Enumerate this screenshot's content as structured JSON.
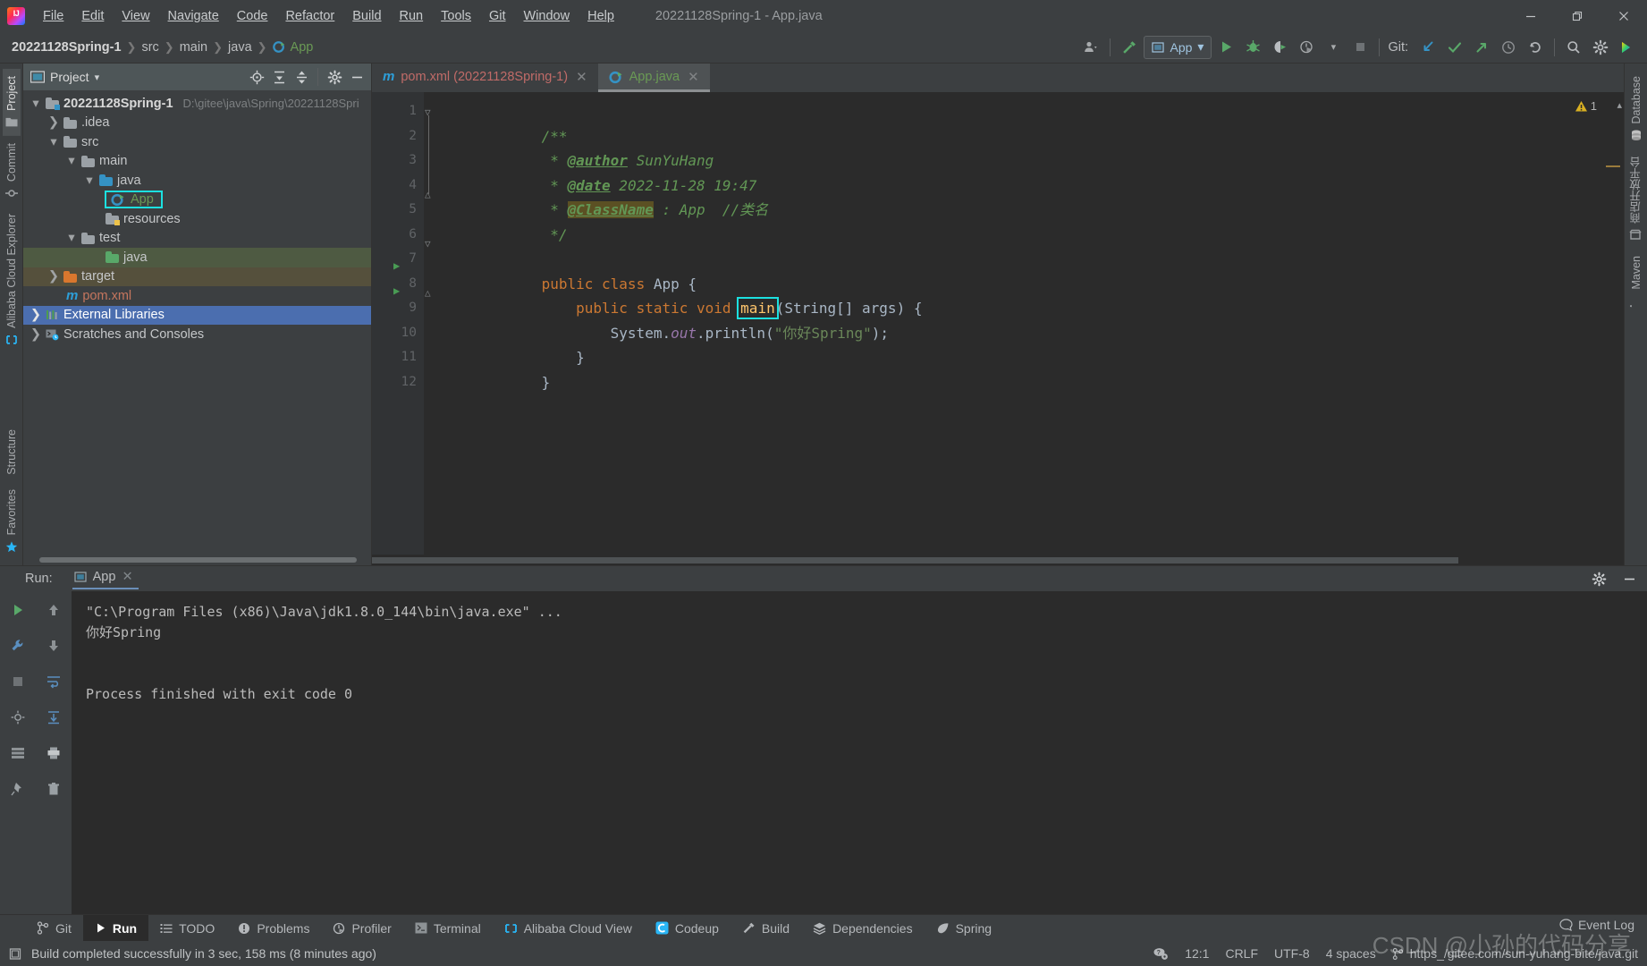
{
  "window": {
    "title": "20221128Spring-1 - App.java",
    "minimize": "minimize-icon",
    "maximize": "maximize-icon",
    "close": "close-icon"
  },
  "menu": [
    {
      "label": "File"
    },
    {
      "label": "Edit"
    },
    {
      "label": "View"
    },
    {
      "label": "Navigate"
    },
    {
      "label": "Code"
    },
    {
      "label": "Refactor"
    },
    {
      "label": "Build"
    },
    {
      "label": "Run"
    },
    {
      "label": "Tools"
    },
    {
      "label": "Git"
    },
    {
      "label": "Window"
    },
    {
      "label": "Help"
    }
  ],
  "breadcrumbs": [
    {
      "label": "20221128Spring-1"
    },
    {
      "label": "src"
    },
    {
      "label": "main"
    },
    {
      "label": "java"
    },
    {
      "label": "App"
    }
  ],
  "toolbar": {
    "run_config": "App",
    "git_label": "Git:",
    "update_project": "update-project-icon",
    "commit": "commit-icon",
    "push": "push-icon",
    "history": "history-icon",
    "rollback": "rollback-icon",
    "search": "search-icon",
    "settings": "settings-icon",
    "run": "run-icon",
    "debug": "debug-icon",
    "run_coverage": "run-coverage-icon",
    "profile": "profile-icon",
    "stop": "stop-icon",
    "build": "build-hammer-icon",
    "account": "account-icon"
  },
  "left_strip": [
    {
      "label": "Project",
      "icon": "project-folder-icon",
      "active": true
    },
    {
      "label": "Commit",
      "icon": "commit-icon",
      "active": false
    },
    {
      "label": "Alibaba Cloud Explorer",
      "icon": "alibaba-cloud-icon",
      "active": false
    }
  ],
  "left_strip_bottom": [
    {
      "label": "Structure",
      "icon": "structure-icon"
    },
    {
      "label": "Favorites",
      "icon": "favorites-star-icon"
    }
  ],
  "right_strip": [
    {
      "label": "Database",
      "icon": "database-icon"
    },
    {
      "label": "商店开放平台",
      "icon": "store-icon"
    },
    {
      "label": "Maven",
      "icon": "maven-m-icon"
    }
  ],
  "project_panel": {
    "title": "Project",
    "buttons": [
      "locate-icon",
      "expand-all-icon",
      "collapse-all-icon",
      "settings-gear-icon",
      "hide-icon"
    ],
    "tree": [
      {
        "label": "20221128Spring-1",
        "path": "D:\\gitee\\java\\Spring\\20221128Spri",
        "indent": 0,
        "arrow": "down",
        "icon": "project-folder-icon",
        "bold": true,
        "highlight": "none"
      },
      {
        "label": ".idea",
        "path": "",
        "indent": 1,
        "arrow": "right",
        "icon": "folder-gray",
        "bold": false,
        "highlight": "none"
      },
      {
        "label": "src",
        "path": "",
        "indent": 1,
        "arrow": "down",
        "icon": "folder-gray",
        "bold": false,
        "highlight": "none"
      },
      {
        "label": "main",
        "path": "",
        "indent": 2,
        "arrow": "down",
        "icon": "folder-gray",
        "bold": false,
        "highlight": "none"
      },
      {
        "label": "java",
        "path": "",
        "indent": 3,
        "arrow": "down",
        "icon": "folder-blue",
        "bold": false,
        "highlight": "none"
      },
      {
        "label": "App",
        "path": "",
        "indent": 4,
        "arrow": "none",
        "icon": "java-class-run-icon",
        "bold": false,
        "highlight": "box"
      },
      {
        "label": "resources",
        "path": "",
        "indent": 3,
        "arrow": "none",
        "icon": "folder-resources",
        "bold": false,
        "highlight": "none"
      },
      {
        "label": "test",
        "path": "",
        "indent": 2,
        "arrow": "down",
        "icon": "folder-gray",
        "bold": false,
        "highlight": "none"
      },
      {
        "label": "java",
        "path": "",
        "indent": 3,
        "arrow": "none",
        "icon": "folder-green",
        "bold": false,
        "highlight": "green"
      },
      {
        "label": "target",
        "path": "",
        "indent": 1,
        "arrow": "right",
        "icon": "folder-orange",
        "bold": false,
        "highlight": "brown"
      },
      {
        "label": "pom.xml",
        "path": "",
        "indent": 2,
        "arrow": "none",
        "icon": "maven-m-icon",
        "bold": false,
        "highlight": "none"
      },
      {
        "label": "External Libraries",
        "path": "",
        "indent": 0,
        "arrow": "right",
        "icon": "libraries-icon",
        "bold": false,
        "highlight": "blue"
      },
      {
        "label": "Scratches and Consoles",
        "path": "",
        "indent": 0,
        "arrow": "right",
        "icon": "scratches-icon",
        "bold": false,
        "highlight": "none"
      }
    ]
  },
  "editor": {
    "tabs": [
      {
        "label": "pom.xml (20221128Spring-1)",
        "icon": "maven-m-icon",
        "active": false
      },
      {
        "label": "App.java",
        "icon": "java-class-run-icon",
        "active": true
      }
    ],
    "warning_count": "1",
    "line_numbers": [
      "1",
      "2",
      "3",
      "4",
      "5",
      "6",
      "7",
      "8",
      "9",
      "10",
      "11",
      "12"
    ],
    "lines": [
      {
        "n": "1",
        "text": "/**"
      },
      {
        "n": "2",
        "text": " * @author SunYuHang"
      },
      {
        "n": "3",
        "text": " * @date 2022-11-28 19:47"
      },
      {
        "n": "4",
        "text": " * @ClassName : App  //类名"
      },
      {
        "n": "5",
        "text": " */"
      },
      {
        "n": "6",
        "text": ""
      },
      {
        "n": "7",
        "text": "public class App {"
      },
      {
        "n": "8",
        "text": "    public static void main(String[] args) {"
      },
      {
        "n": "9",
        "text": "        System.out.println(\"你好Spring\");"
      },
      {
        "n": "10",
        "text": "    }"
      },
      {
        "n": "11",
        "text": "}"
      },
      {
        "n": "12",
        "text": ""
      }
    ],
    "tokens": {
      "doc_open": "/**",
      "star": " * ",
      "author_tag": "@author",
      "author_val": " SunYuHang",
      "date_tag": "@date",
      "date_val": " 2022-11-28 19:47",
      "classname_tag": "@ClassName",
      "classname_val": " : App  //类名",
      "doc_close": " */",
      "kw_public": "public",
      "kw_class": "class",
      "class_name": "App",
      "brace_open": "{",
      "kw_static": "static",
      "kw_void": "void",
      "method_main": "main",
      "main_params": "(String[] args) {",
      "sys": "System.",
      "out": "out",
      "println": ".println(",
      "hello_str": "\"你好Spring\"",
      "stmt_end": ");",
      "brace_close_inner": "}",
      "brace_close_outer": "}"
    }
  },
  "run_panel": {
    "label": "Run:",
    "tab": "App",
    "close": "close-icon",
    "settings": "settings-gear-icon",
    "hide": "hide-icon",
    "tools": [
      "rerun-icon",
      "stop-icon",
      "wrench-icon",
      "trash-icon",
      "print-icon",
      "soft-wrap-icon",
      "scroll-end-icon",
      "up-icon",
      "down-icon",
      "print-icon"
    ],
    "console": [
      {
        "text": "\"C:\\Program Files (x86)\\Java\\jdk1.8.0_144\\bin\\java.exe\" ...",
        "style": "cmd"
      },
      {
        "text": "你好Spring",
        "style": "plain"
      },
      {
        "text": "",
        "style": "plain"
      },
      {
        "text": "Process finished with exit code 0",
        "style": "plain"
      }
    ]
  },
  "bottom_tools": [
    {
      "label": "Git",
      "icon": "git-branch-icon",
      "active": false
    },
    {
      "label": "Run",
      "icon": "run-icon",
      "active": true
    },
    {
      "label": "TODO",
      "icon": "todo-list-icon",
      "active": false
    },
    {
      "label": "Problems",
      "icon": "problems-icon",
      "active": false
    },
    {
      "label": "Profiler",
      "icon": "profiler-icon",
      "active": false
    },
    {
      "label": "Terminal",
      "icon": "terminal-icon",
      "active": false
    },
    {
      "label": "Alibaba Cloud View",
      "icon": "alibaba-cloud-icon",
      "active": false
    },
    {
      "label": "Codeup",
      "icon": "codeup-icon",
      "active": false
    },
    {
      "label": "Build",
      "icon": "build-hammer-icon",
      "active": false
    },
    {
      "label": "Dependencies",
      "icon": "dependencies-icon",
      "active": false
    },
    {
      "label": "Spring",
      "icon": "spring-leaf-icon",
      "active": false
    }
  ],
  "status": {
    "message": "Build completed successfully in 3 sec, 158 ms (8 minutes ago)",
    "build_icon": "build-status-icon",
    "inspection_icon": "inspections-icon",
    "caret": "12:1",
    "line_separator": "CRLF",
    "encoding": "UTF-8",
    "indent": "4 spaces",
    "vcs_branch": "https_/gitee.com/sun-yuhang-bite/java.git",
    "vcs_icon": "git-branch-icon",
    "event_log": "Event Log"
  },
  "watermark": "CSDN @小孙的代码分享",
  "colors": {
    "accent_cyan": "#1ce0e0",
    "bg_panel": "#3c3f41",
    "bg_editor": "#2b2b2b",
    "selection_blue": "#4b6eaf",
    "green": "#6a9a55",
    "orange": "#cc7832"
  }
}
